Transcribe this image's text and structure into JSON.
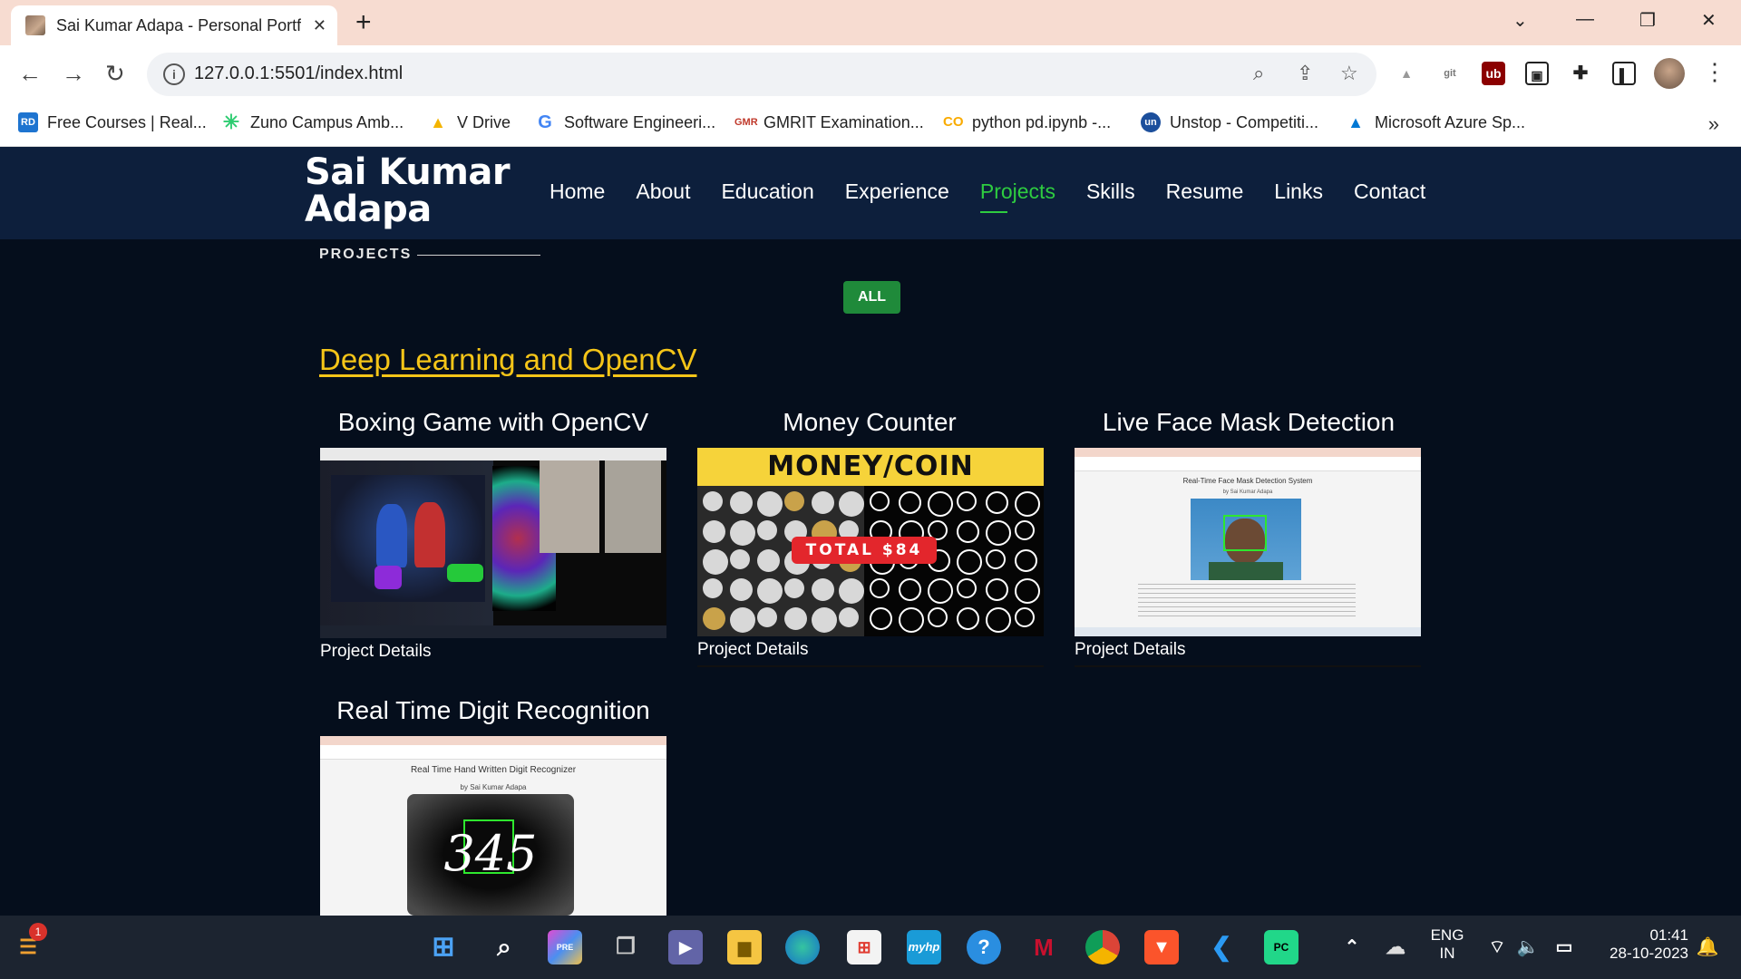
{
  "browser": {
    "tab_title": "Sai Kumar Adapa - Personal Portfolio",
    "url": "127.0.0.1:5501/index.html",
    "bookmarks": [
      {
        "label": "Free Courses | Real...",
        "icon": "rd-icon",
        "color": "#1e74d0"
      },
      {
        "label": "Zuno Campus Amb...",
        "icon": "zuno-icon",
        "color": "#2ecc71"
      },
      {
        "label": "V Drive",
        "icon": "google-drive-icon",
        "color": "#f4b400"
      },
      {
        "label": "Software Engineeri...",
        "icon": "google-icon",
        "color": "#4285f4"
      },
      {
        "label": "GMRIT Examination...",
        "icon": "gmr-icon",
        "color": "#c0392b"
      },
      {
        "label": "python pd.ipynb -...",
        "icon": "colab-icon",
        "color": "#f9ab00"
      },
      {
        "label": "Unstop - Competiti...",
        "icon": "unstop-icon",
        "color": "#1c4f9c"
      },
      {
        "label": "Microsoft Azure Sp...",
        "icon": "azure-icon",
        "color": "#0078d4"
      }
    ]
  },
  "site": {
    "logo_line1": "Sai Kumar",
    "logo_line2": "Adapa",
    "nav": [
      "Home",
      "About",
      "Education",
      "Experience",
      "Projects",
      "Skills",
      "Resume",
      "Links",
      "Contact"
    ],
    "active_nav": "Projects",
    "section_label": "PROJECTS",
    "filter_all": "ALL",
    "category": "Deep Learning and OpenCV",
    "projects": [
      {
        "title": "Boxing Game with OpenCV",
        "details": "Project Details"
      },
      {
        "title": "Money Counter",
        "details": "Project Details",
        "banner": "MONEY/COIN COUNTER",
        "badge": "TOTAL $84"
      },
      {
        "title": "Live Face Mask Detection",
        "details": "Project Details",
        "shot_heading": "Real-Time Face Mask Detection System",
        "shot_byline": "by Sai Kumar Adapa"
      },
      {
        "title": "Real Time Digit Recognition",
        "details": "Project Details",
        "shot_heading": "Real Time Hand Written Digit Recognizer",
        "shot_byline": "by Sai Kumar Adapa",
        "digits": "345"
      }
    ],
    "colors": {
      "header_bg": "#0d1f3c",
      "page_bg": "#050e1c",
      "accent_green": "#2ecc40",
      "category_yellow": "#f5c518",
      "filter_bg": "#1f8a3a"
    }
  },
  "taskbar": {
    "notification_count": "1",
    "lang_line1": "ENG",
    "lang_line2": "IN",
    "time": "01:41",
    "date": "28-10-2023"
  }
}
